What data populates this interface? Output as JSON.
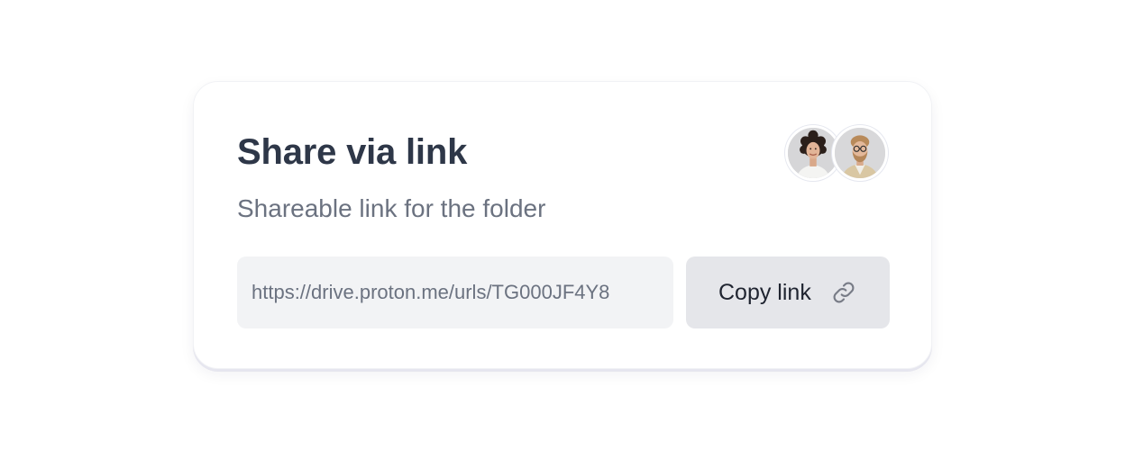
{
  "card": {
    "title": "Share via link",
    "subtitle": "Shareable link for the folder"
  },
  "avatars": [
    {
      "icon": "avatar-woman-curly-hair"
    },
    {
      "icon": "avatar-man-glasses"
    }
  ],
  "link_field": {
    "value": "https://drive.proton.me/urls/TG000JF4Y8"
  },
  "copy_button": {
    "label": "Copy link",
    "icon": "link-icon"
  },
  "colors": {
    "title": "#2e3748",
    "subtitle": "#6b7280",
    "field_bg": "#f2f3f5",
    "button_bg": "#e5e6ea"
  }
}
